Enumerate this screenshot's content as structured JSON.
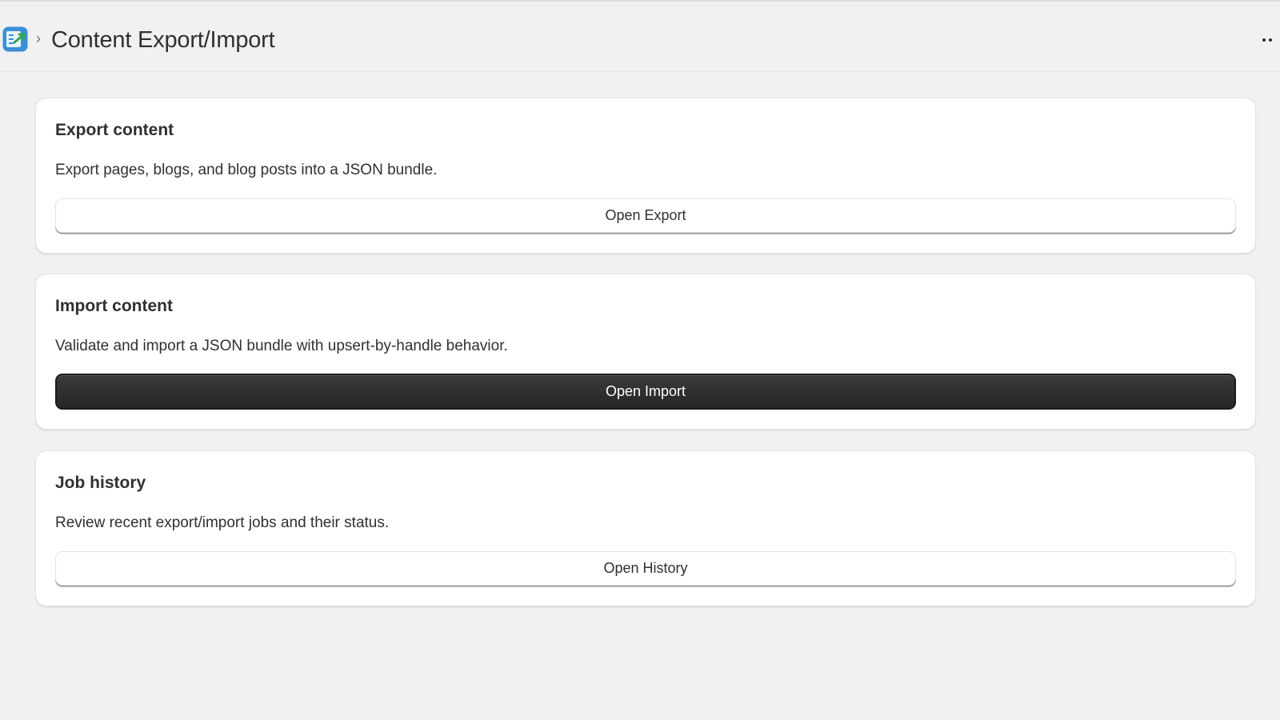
{
  "header": {
    "breadcrumb_separator": "›",
    "title": "Content Export/Import",
    "app_icon": "app-icon",
    "more_icon": "more-horizontal-icon"
  },
  "cards": [
    {
      "title": "Export content",
      "description": "Export pages, blogs, and blog posts into a JSON bundle.",
      "button_label": "Open Export",
      "button_style": "secondary"
    },
    {
      "title": "Import content",
      "description": "Validate and import a JSON bundle with upsert-by-handle behavior.",
      "button_label": "Open Import",
      "button_style": "primary"
    },
    {
      "title": "Job history",
      "description": "Review recent export/import jobs and their status.",
      "button_label": "Open History",
      "button_style": "secondary"
    }
  ],
  "colors": {
    "background": "#f1f1f1",
    "card": "#ffffff",
    "text": "#303030",
    "primary_button": "#303030"
  }
}
